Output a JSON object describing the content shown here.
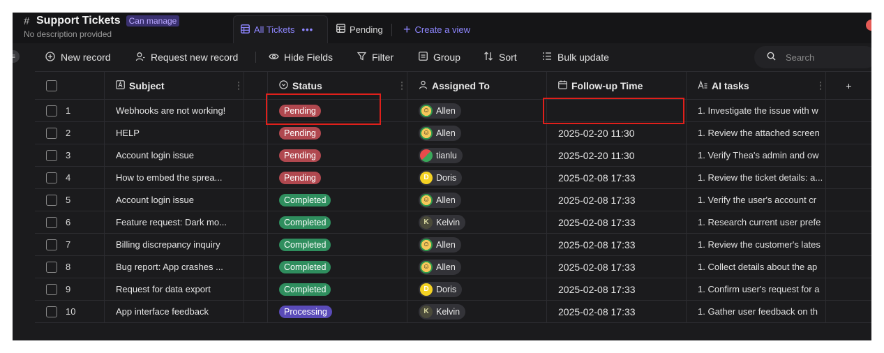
{
  "header": {
    "hash_icon": "hash-icon",
    "title": "Support Tickets",
    "permission_badge": "Can manage",
    "description": "No description provided",
    "views": [
      {
        "label": "All Tickets",
        "icon": "table-icon",
        "more": "•••"
      },
      {
        "label": "Pending",
        "icon": "table-icon"
      }
    ],
    "create_view_label": "Create a view"
  },
  "toolbar": {
    "new_record": "New record",
    "request_new_record": "Request new record",
    "hide_fields": "Hide Fields",
    "filter": "Filter",
    "group": "Group",
    "sort": "Sort",
    "bulk_update": "Bulk update",
    "search_placeholder": "Search"
  },
  "columns": {
    "subject": "Subject",
    "status": "Status",
    "assigned_to": "Assigned To",
    "follow_up_time": "Follow-up Time",
    "ai_tasks": "AI tasks",
    "add_column": "+"
  },
  "rows": [
    {
      "num": "1",
      "subject": "Webhooks are not working!",
      "status": "Pending",
      "status_type": "pending",
      "assignee": "Allen",
      "avatar": "allen",
      "follow_up": "",
      "ai": "1. Investigate the issue with w"
    },
    {
      "num": "2",
      "subject": "HELP",
      "status": "Pending",
      "status_type": "pending",
      "assignee": "Allen",
      "avatar": "allen",
      "follow_up": "2025-02-20 11:30",
      "ai": "1. Review the attached screen"
    },
    {
      "num": "3",
      "subject": "Account login issue",
      "status": "Pending",
      "status_type": "pending",
      "assignee": "tianlu",
      "avatar": "tianlu",
      "follow_up": "2025-02-20 11:30",
      "ai": "1. Verify Thea's admin and ow"
    },
    {
      "num": "4",
      "subject": "How to embed the sprea...",
      "status": "Pending",
      "status_type": "pending",
      "assignee": "Doris",
      "avatar": "doris",
      "follow_up": "2025-02-08 17:33",
      "ai": "1. Review the ticket details: a..."
    },
    {
      "num": "5",
      "subject": "Account login issue",
      "status": "Completed",
      "status_type": "completed",
      "assignee": "Allen",
      "avatar": "allen",
      "follow_up": "2025-02-08 17:33",
      "ai": "1. Verify the user's account cr"
    },
    {
      "num": "6",
      "subject": "Feature request: Dark mo...",
      "status": "Completed",
      "status_type": "completed",
      "assignee": "Kelvin",
      "avatar": "kelvin",
      "follow_up": "2025-02-08 17:33",
      "ai": "1. Research current user prefe"
    },
    {
      "num": "7",
      "subject": "Billing discrepancy inquiry",
      "status": "Completed",
      "status_type": "completed",
      "assignee": "Allen",
      "avatar": "allen",
      "follow_up": "2025-02-08 17:33",
      "ai": "1. Review the customer's lates"
    },
    {
      "num": "8",
      "subject": "Bug report: App crashes ...",
      "status": "Completed",
      "status_type": "completed",
      "assignee": "Allen",
      "avatar": "allen",
      "follow_up": "2025-02-08 17:33",
      "ai": "1. Collect details about the ap"
    },
    {
      "num": "9",
      "subject": "Request for data export",
      "status": "Completed",
      "status_type": "completed",
      "assignee": "Doris",
      "avatar": "doris",
      "follow_up": "2025-02-08 17:33",
      "ai": "1. Confirm user's request for a"
    },
    {
      "num": "10",
      "subject": "App interface feedback",
      "status": "Processing",
      "status_type": "processing",
      "assignee": "Kelvin",
      "avatar": "kelvin",
      "follow_up": "2025-02-08 17:33",
      "ai": "1. Gather user feedback on th"
    }
  ],
  "avatar_glyphs": {
    "allen": "☺",
    "tianlu": "",
    "doris": "D",
    "kelvin": "K"
  },
  "colors": {
    "accent": "#8e86ff",
    "pending": "#b0484f",
    "completed": "#2f8e5e",
    "processing": "#5a4bb8",
    "highlight": "#e0201b"
  }
}
